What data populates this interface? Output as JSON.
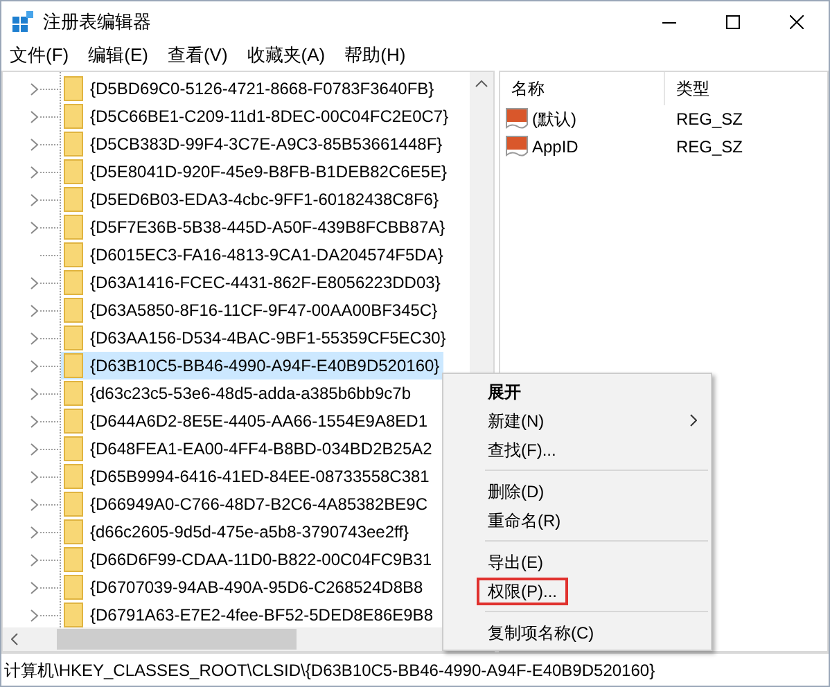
{
  "window": {
    "title": "注册表编辑器"
  },
  "menu_bar": [
    "文件(F)",
    "编辑(E)",
    "查看(V)",
    "收藏夹(A)",
    "帮助(H)"
  ],
  "tree": {
    "items": [
      {
        "label": "{D5BD69C0-5126-4721-8668-F0783F3640FB}",
        "has_children": true,
        "selected": false
      },
      {
        "label": "{D5C66BE1-C209-11d1-8DEC-00C04FC2E0C7}",
        "has_children": true,
        "selected": false
      },
      {
        "label": "{D5CB383D-99F4-3C7E-A9C3-85B53661448F}",
        "has_children": true,
        "selected": false
      },
      {
        "label": "{D5E8041D-920F-45e9-B8FB-B1DEB82C6E5E}",
        "has_children": true,
        "selected": false
      },
      {
        "label": "{D5ED6B03-EDA3-4cbc-9FF1-60182438C8F6}",
        "has_children": true,
        "selected": false
      },
      {
        "label": "{D5F7E36B-5B38-445D-A50F-439B8FCBB87A}",
        "has_children": true,
        "selected": false
      },
      {
        "label": "{D6015EC3-FA16-4813-9CA1-DA204574F5DA}",
        "has_children": false,
        "selected": false
      },
      {
        "label": "{D63A1416-FCEC-4431-862F-E8056223DD03}",
        "has_children": true,
        "selected": false
      },
      {
        "label": "{D63A5850-8F16-11CF-9F47-00AA00BF345C}",
        "has_children": true,
        "selected": false
      },
      {
        "label": "{D63AA156-D534-4BAC-9BF1-55359CF5EC30}",
        "has_children": true,
        "selected": false
      },
      {
        "label": "{D63B10C5-BB46-4990-A94F-E40B9D520160}",
        "has_children": true,
        "selected": true
      },
      {
        "label": "{d63c23c5-53e6-48d5-adda-a385b6bb9c7b",
        "has_children": true,
        "selected": false
      },
      {
        "label": "{D644A6D2-8E5E-4405-AA66-1554E9A8ED1",
        "has_children": true,
        "selected": false
      },
      {
        "label": "{D648FEA1-EA00-4FF4-B8BD-034BD2B25A2",
        "has_children": true,
        "selected": false
      },
      {
        "label": "{D65B9994-6416-41ED-84EE-08733558C381",
        "has_children": true,
        "selected": false
      },
      {
        "label": "{D66949A0-C766-48D7-B2C6-4A85382BE9C",
        "has_children": true,
        "selected": false
      },
      {
        "label": "{d66c2605-9d5d-475e-a5b8-3790743ee2ff}",
        "has_children": true,
        "selected": false
      },
      {
        "label": "{D66D6F99-CDAA-11D0-B822-00C04FC9B31",
        "has_children": true,
        "selected": false
      },
      {
        "label": "{D6707039-94AB-490A-95D6-C268524D8B8",
        "has_children": true,
        "selected": false
      },
      {
        "label": "{D6791A63-E7E2-4fee-BF52-5DED8E86E9B8",
        "has_children": true,
        "selected": false
      }
    ]
  },
  "values": {
    "columns": [
      "名称",
      "类型"
    ],
    "rows": [
      {
        "name": "(默认)",
        "type": "REG_SZ"
      },
      {
        "name": "AppID",
        "type": "REG_SZ"
      }
    ]
  },
  "context_menu": [
    {
      "kind": "item",
      "label": "展开",
      "bold": true,
      "submenu": false,
      "highlighted": false
    },
    {
      "kind": "item",
      "label": "新建(N)",
      "bold": false,
      "submenu": true,
      "highlighted": false
    },
    {
      "kind": "item",
      "label": "查找(F)...",
      "bold": false,
      "submenu": false,
      "highlighted": false
    },
    {
      "kind": "separator"
    },
    {
      "kind": "item",
      "label": "删除(D)",
      "bold": false,
      "submenu": false,
      "highlighted": false
    },
    {
      "kind": "item",
      "label": "重命名(R)",
      "bold": false,
      "submenu": false,
      "highlighted": false
    },
    {
      "kind": "separator"
    },
    {
      "kind": "item",
      "label": "导出(E)",
      "bold": false,
      "submenu": false,
      "highlighted": false
    },
    {
      "kind": "item",
      "label": "权限(P)...",
      "bold": false,
      "submenu": false,
      "highlighted": true
    },
    {
      "kind": "separator"
    },
    {
      "kind": "item",
      "label": "复制项名称(C)",
      "bold": false,
      "submenu": false,
      "highlighted": false
    }
  ],
  "status_bar": "计算机\\HKEY_CLASSES_ROOT\\CLSID\\{D63B10C5-BB46-4990-A94F-E40B9D520160}"
}
